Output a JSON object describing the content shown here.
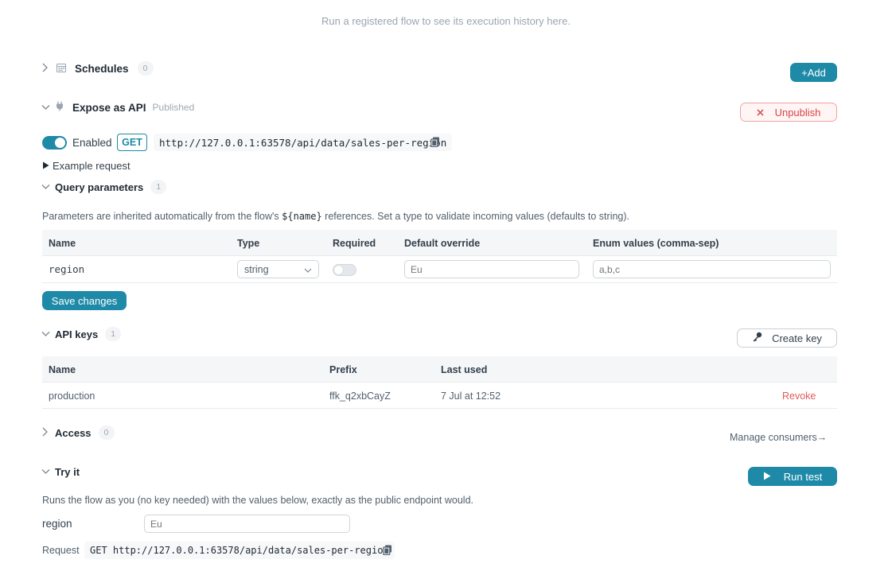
{
  "runs_hint": "Run a registered flow to see its execution history here.",
  "schedules": {
    "title": "Schedules",
    "count": "0",
    "add_label": "+Add"
  },
  "expose": {
    "title": "Expose as API",
    "status": "Published",
    "unpublish_label": "Unpublish",
    "enabled_label": "Enabled",
    "method": "GET",
    "url": "http://127.0.0.1:63578/api/data/sales-per-region",
    "example_request_label": "Example request"
  },
  "query_params": {
    "title": "Query parameters",
    "count": "1",
    "description_before": "Parameters are inherited automatically from the flow's ",
    "description_code": "${name}",
    "description_after": " references. Set a type to validate incoming values (defaults to string).",
    "columns": [
      "Name",
      "Type",
      "Required",
      "Default override",
      "Enum values (comma-sep)"
    ],
    "rows": [
      {
        "name": "region",
        "type": "string",
        "required": false,
        "default_placeholder": "Eu",
        "enum_placeholder": "a,b,c"
      }
    ],
    "save_label": "Save changes"
  },
  "api_keys": {
    "title": "API keys",
    "count": "1",
    "create_label": "Create key",
    "columns": [
      "Name",
      "Prefix",
      "Last used"
    ],
    "rows": [
      {
        "name": "production",
        "prefix": "ffk_q2xbCayZ",
        "last_used": "7 Jul at 12:52",
        "action": "Revoke"
      }
    ]
  },
  "access": {
    "title": "Access",
    "count": "0",
    "manage_label": "Manage consumers→"
  },
  "try_it": {
    "title": "Try it",
    "run_label": "Run test",
    "description": "Runs the flow as you (no key needed) with the values below, exactly as the public endpoint would.",
    "param_label": "region",
    "param_placeholder": "Eu",
    "request_label": "Request",
    "request_value": "GET http://127.0.0.1:63578/api/data/sales-per-region"
  },
  "colors": {
    "accent": "#1e8aa8",
    "danger": "#d64545",
    "muted": "#a0a8b2"
  },
  "icons": {
    "schedules": "calendar-icon",
    "expose": "plug-icon",
    "copy": "copy-icon",
    "key": "key-icon",
    "play": "play-icon",
    "close": "close-icon"
  }
}
